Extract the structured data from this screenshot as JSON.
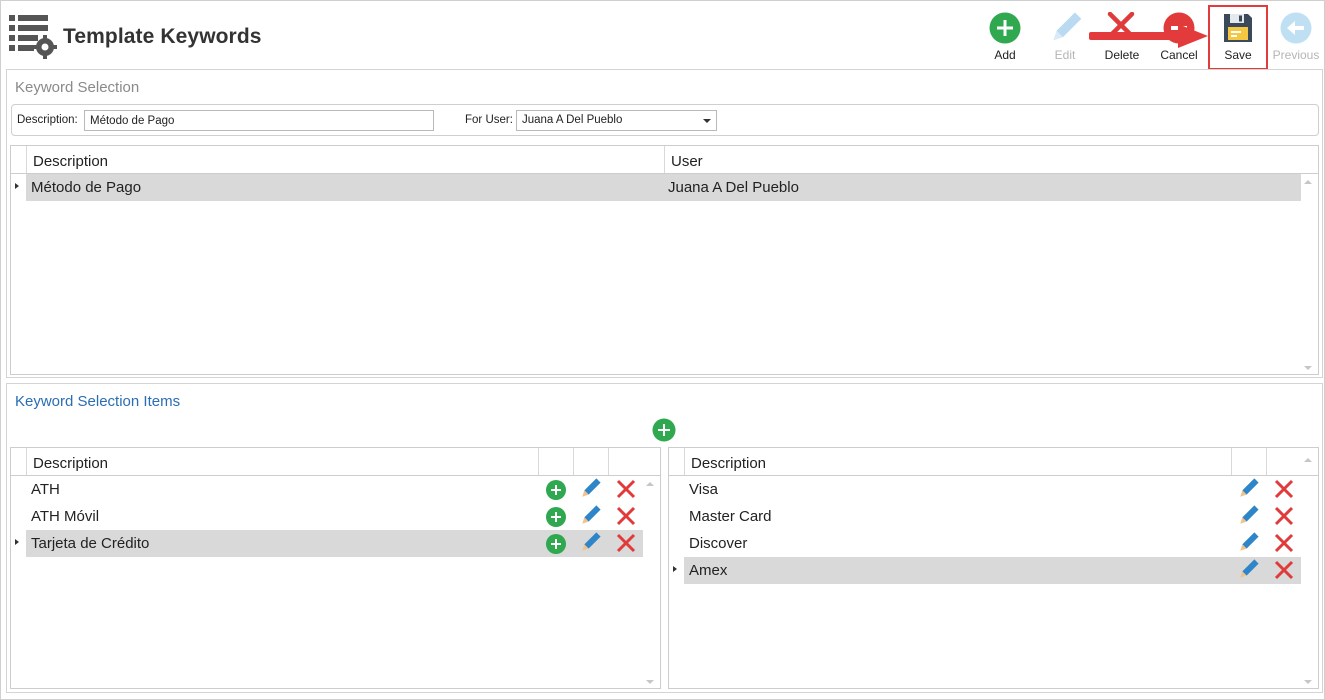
{
  "header": {
    "title": "Template Keywords",
    "toolbar": {
      "add_label": "Add",
      "edit_label": "Edit",
      "delete_label": "Delete",
      "cancel_label": "Cancel",
      "save_label": "Save",
      "previous_label": "Previous"
    }
  },
  "keyword_selection": {
    "section_title": "Keyword Selection",
    "description_label": "Description:",
    "description_value": "Método de Pago",
    "for_user_label": "For User:",
    "for_user_value": "Juana A Del Pueblo",
    "grid": {
      "columns": [
        "Description",
        "User"
      ],
      "rows": [
        {
          "description": "Método de Pago",
          "user": "Juana A Del Pueblo"
        }
      ]
    }
  },
  "keyword_items": {
    "section_title": "Keyword Selection Items",
    "left_grid": {
      "column": "Description",
      "rows": [
        "ATH",
        "ATH Móvil",
        "Tarjeta de Crédito"
      ]
    },
    "right_grid": {
      "column": "Description",
      "rows": [
        "Visa",
        "Master Card",
        "Discover",
        "Amex"
      ]
    }
  },
  "colors": {
    "add_green": "#2fa84f",
    "edit_blue": "#2e86c9",
    "delete_red": "#e03a3a",
    "highlight_red": "#e33b3b",
    "selected_row": "#d9d9d9",
    "section_title_blue": "#2a6db5"
  },
  "icons": {
    "app": "list-gear-icon",
    "add": "plus-circle-icon",
    "edit": "pencil-icon",
    "delete": "x-icon",
    "cancel": "cancel-circle-icon",
    "save": "floppy-disk-icon",
    "previous": "arrow-left-circle-icon"
  }
}
